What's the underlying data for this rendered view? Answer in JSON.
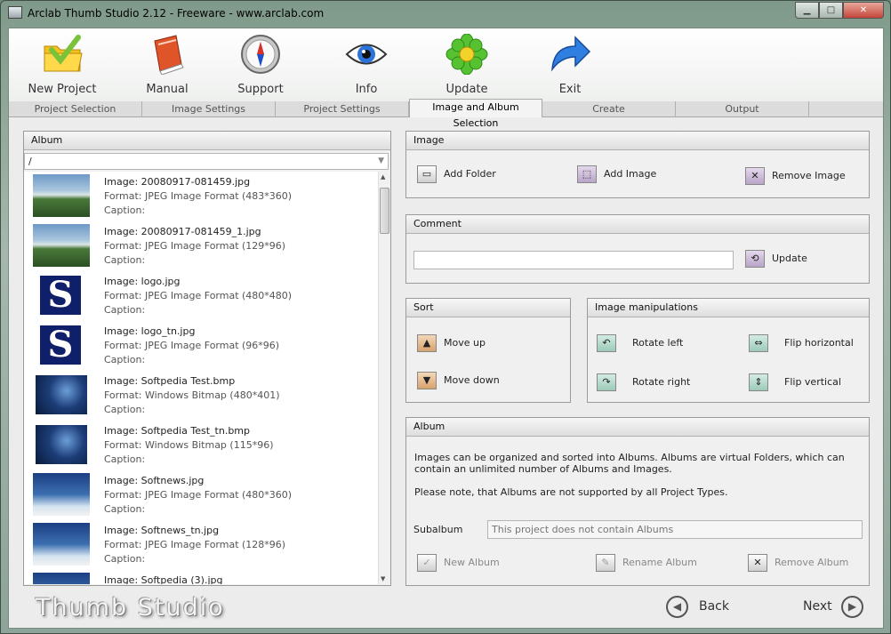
{
  "window": {
    "title": "Arclab Thumb Studio 2.12 - Freeware - www.arclab.com"
  },
  "toolbar": {
    "buttons": [
      {
        "label": "New Project",
        "icon": "folder-check-icon"
      },
      {
        "label": "Manual",
        "icon": "book-icon"
      },
      {
        "label": "Support",
        "icon": "compass-icon"
      },
      {
        "label": "Info",
        "icon": "eye-icon"
      },
      {
        "label": "Update",
        "icon": "flower-icon"
      },
      {
        "label": "Exit",
        "icon": "arrow-icon"
      }
    ]
  },
  "tabs": [
    {
      "label": "Project Selection"
    },
    {
      "label": "Image Settings"
    },
    {
      "label": "Project Settings"
    },
    {
      "label": "Image and Album Selection",
      "active": true
    },
    {
      "label": "Create"
    },
    {
      "label": "Output"
    }
  ],
  "album_panel": {
    "header": "Album",
    "path": "/",
    "images": [
      {
        "name": "Image: 20080917-081459.jpg",
        "format": "Format: JPEG Image Format (483*360)",
        "caption": "Caption:"
      },
      {
        "name": "Image: 20080917-081459_1.jpg",
        "format": "Format: JPEG Image Format (129*96)",
        "caption": "Caption:"
      },
      {
        "name": "Image: logo.jpg",
        "format": "Format: JPEG Image Format (480*480)",
        "caption": "Caption:"
      },
      {
        "name": "Image: logo_tn.jpg",
        "format": "Format: JPEG Image Format (96*96)",
        "caption": "Caption:"
      },
      {
        "name": "Image: Softpedia Test.bmp",
        "format": "Format: Windows Bitmap (480*401)",
        "caption": "Caption:"
      },
      {
        "name": "Image: Softpedia Test_tn.bmp",
        "format": "Format: Windows Bitmap (115*96)",
        "caption": "Caption:"
      },
      {
        "name": "Image: Softnews.jpg",
        "format": "Format: JPEG Image Format (480*360)",
        "caption": "Caption:"
      },
      {
        "name": "Image: Softnews_tn.jpg",
        "format": "Format: JPEG Image Format (128*96)",
        "caption": "Caption:"
      },
      {
        "name": "Image: Softpedia (3).jpg",
        "format": "",
        "caption": ""
      }
    ]
  },
  "image_panel": {
    "header": "Image",
    "add_folder": "Add Folder",
    "add_image": "Add Image",
    "remove_image": "Remove Image"
  },
  "comment_panel": {
    "header": "Comment",
    "value": "",
    "update": "Update"
  },
  "sort_panel": {
    "header": "Sort",
    "move_up": "Move up",
    "move_down": "Move down"
  },
  "manip_panel": {
    "header": "Image manipulations",
    "rotate_left": "Rotate left",
    "rotate_right": "Rotate right",
    "flip_horizontal": "Flip horizontal",
    "flip_vertical": "Flip vertical"
  },
  "album_info_panel": {
    "header": "Album",
    "text1": "Images can be organized and sorted into Albums. Albums are virtual Folders, which can contain an unlimited number of Albums and Images.",
    "text2": "Please note, that Albums are not supported by all Project Types.",
    "subalbum_label": "Subalbum",
    "subalbum_placeholder": "This project does not contain Albums",
    "new_album": "New Album",
    "rename_album": "Rename Album",
    "remove_album": "Remove Album"
  },
  "footer": {
    "brand": "Thumb Studio",
    "back": "Back",
    "next": "Next"
  }
}
